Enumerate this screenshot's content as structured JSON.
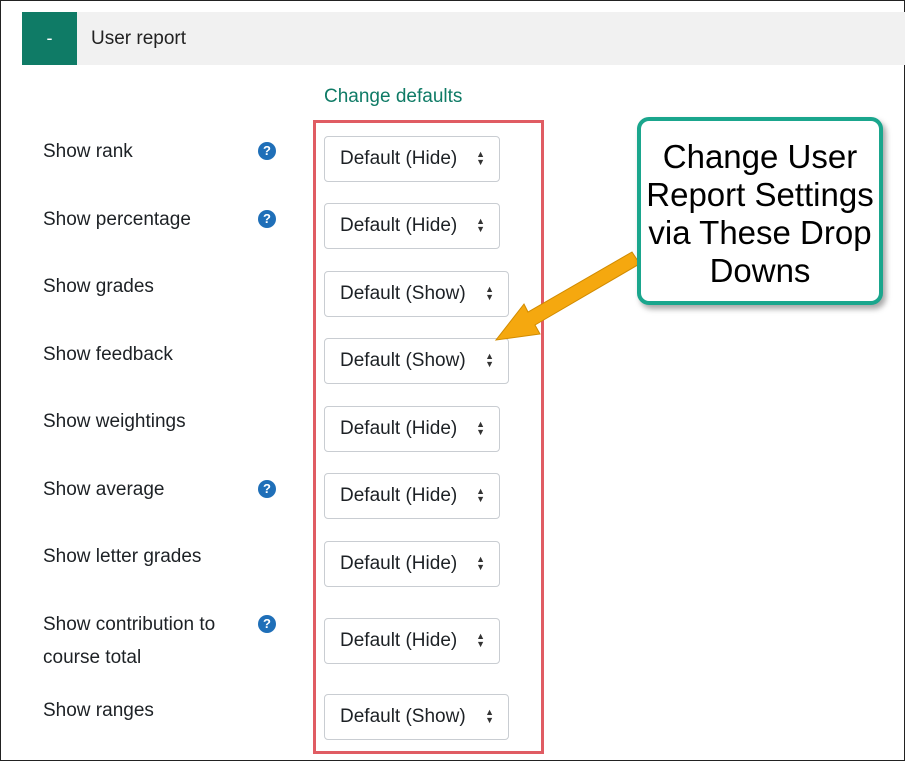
{
  "header": {
    "toggle_symbol": "-",
    "title": "User report"
  },
  "change_defaults_label": "Change defaults",
  "rows": [
    {
      "label": "Show rank",
      "value": "Default (Hide)",
      "help": true
    },
    {
      "label": "Show percentage",
      "value": "Default (Hide)",
      "help": true
    },
    {
      "label": "Show grades",
      "value": "Default (Show)",
      "help": false
    },
    {
      "label": "Show feedback",
      "value": "Default (Show)",
      "help": false
    },
    {
      "label": "Show weightings",
      "value": "Default (Hide)",
      "help": false
    },
    {
      "label": "Show average",
      "value": "Default (Hide)",
      "help": true
    },
    {
      "label": "Show letter grades",
      "value": "Default (Hide)",
      "help": false
    },
    {
      "label": "Show contribution to course total",
      "value": "Default (Hide)",
      "help": true
    },
    {
      "label": "Show ranges",
      "value": "Default (Show)",
      "help": false
    }
  ],
  "help_icon_glyph": "?",
  "callout": {
    "lines": [
      "Change User",
      "Report Settings",
      "via These Drop",
      "Downs"
    ]
  },
  "colors": {
    "accent": "#0f7b66",
    "highlight_box": "#e05c63",
    "callout_border": "#1aa68d",
    "arrow": "#f5a80f",
    "help_icon": "#1f6fb8"
  }
}
